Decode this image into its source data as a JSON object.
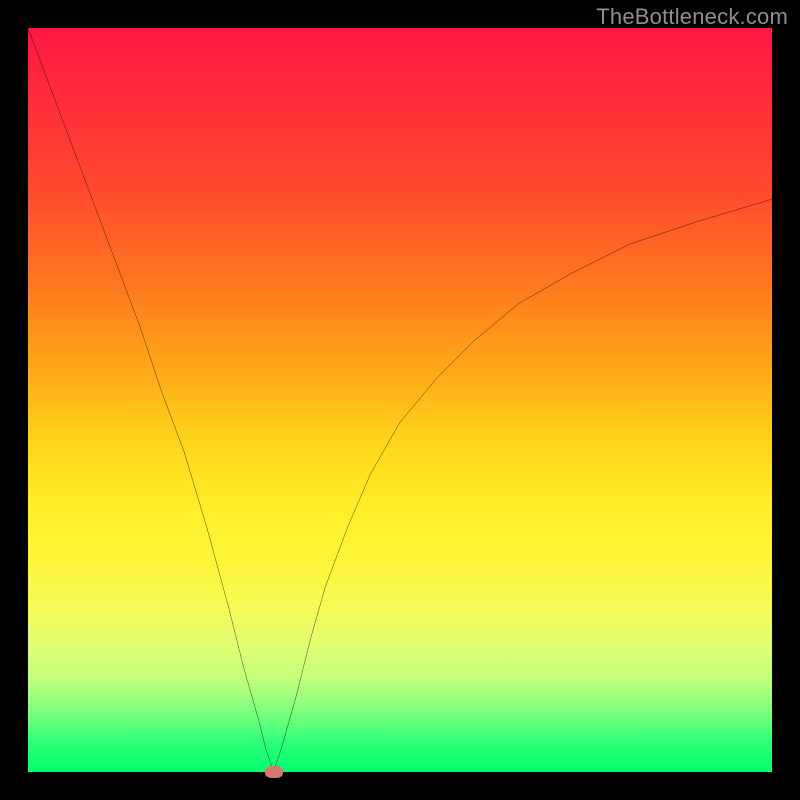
{
  "watermark": "TheBottleneck.com",
  "chart_data": {
    "type": "line",
    "title": "",
    "xlabel": "",
    "ylabel": "",
    "xlim": [
      0,
      100
    ],
    "ylim": [
      0,
      100
    ],
    "grid": false,
    "background_gradient": {
      "direction": "vertical",
      "stops": [
        {
          "pos": 0,
          "color": "#ff1744"
        },
        {
          "pos": 55,
          "color": "#ffd21a"
        },
        {
          "pos": 100,
          "color": "#00ff70"
        }
      ]
    },
    "series": [
      {
        "name": "bottleneck-curve",
        "color": "#000000",
        "x": [
          0,
          3,
          6,
          9,
          12,
          15,
          18,
          21,
          24,
          27,
          29,
          31,
          32,
          33,
          34,
          36,
          38,
          40,
          43,
          46,
          50,
          55,
          60,
          66,
          73,
          81,
          90,
          100
        ],
        "y": [
          100,
          92,
          84,
          76,
          68,
          60,
          51,
          43,
          33,
          22,
          14,
          7,
          3,
          0,
          3,
          10,
          18,
          25,
          33,
          40,
          47,
          53,
          58,
          63,
          67,
          71,
          74,
          77
        ]
      }
    ],
    "markers": [
      {
        "name": "bottleneck-marker",
        "x": 33,
        "y": 0,
        "color": "#d37a70"
      }
    ]
  }
}
